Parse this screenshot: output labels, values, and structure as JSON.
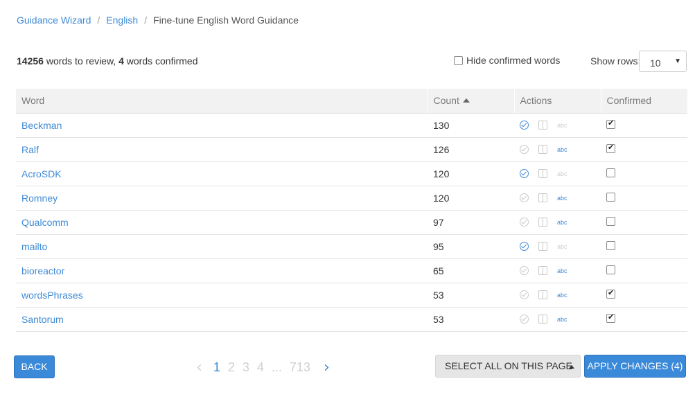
{
  "breadcrumb": {
    "items": [
      "Guidance Wizard",
      "English"
    ],
    "current": "Fine-tune English Word Guidance",
    "separator": "/"
  },
  "summary": {
    "to_review_count": "14256",
    "to_review_text": " words to review, ",
    "confirmed_count": "4",
    "confirmed_text": " words confirmed"
  },
  "hide_confirmed": {
    "label": "Hide confirmed words",
    "checked": false
  },
  "show_rows": {
    "label": "Show rows:",
    "value": "10"
  },
  "table": {
    "headers": {
      "word": "Word",
      "count": "Count",
      "actions": "Actions",
      "confirmed": "Confirmed"
    },
    "sort": {
      "column": "count",
      "direction": "ascending-indicator"
    },
    "rows": [
      {
        "word": "Beckman",
        "count": "130",
        "check_active": true,
        "abc_active": false,
        "confirmed": true
      },
      {
        "word": "Ralf",
        "count": "126",
        "check_active": false,
        "abc_active": true,
        "confirmed": true
      },
      {
        "word": "AcroSDK",
        "count": "120",
        "check_active": true,
        "abc_active": false,
        "confirmed": false
      },
      {
        "word": "Romney",
        "count": "120",
        "check_active": false,
        "abc_active": true,
        "confirmed": false
      },
      {
        "word": "Qualcomm",
        "count": "97",
        "check_active": false,
        "abc_active": true,
        "confirmed": false
      },
      {
        "word": "mailto",
        "count": "95",
        "check_active": true,
        "abc_active": false,
        "confirmed": false
      },
      {
        "word": "bioreactor",
        "count": "65",
        "check_active": false,
        "abc_active": true,
        "confirmed": false
      },
      {
        "word": "wordsPhrases",
        "count": "53",
        "check_active": false,
        "abc_active": true,
        "confirmed": true
      },
      {
        "word": "Santorum",
        "count": "53",
        "check_active": false,
        "abc_active": true,
        "confirmed": true
      }
    ],
    "abc_label": "abc"
  },
  "footer": {
    "back_label": "BACK",
    "pagination": {
      "pages": [
        "1",
        "2",
        "3",
        "4",
        "...",
        "713"
      ],
      "current": "1",
      "prev_icon": "chevron-left-icon",
      "next_icon": "chevron-right-icon"
    },
    "select_all_label": "SELECT ALL ON THIS PAGE",
    "apply_label": "APPLY CHANGES (4)"
  },
  "colors": {
    "accent": "#3f8ad5",
    "button_primary": "#3a8ad9",
    "header_bg": "#f2f2f2"
  }
}
